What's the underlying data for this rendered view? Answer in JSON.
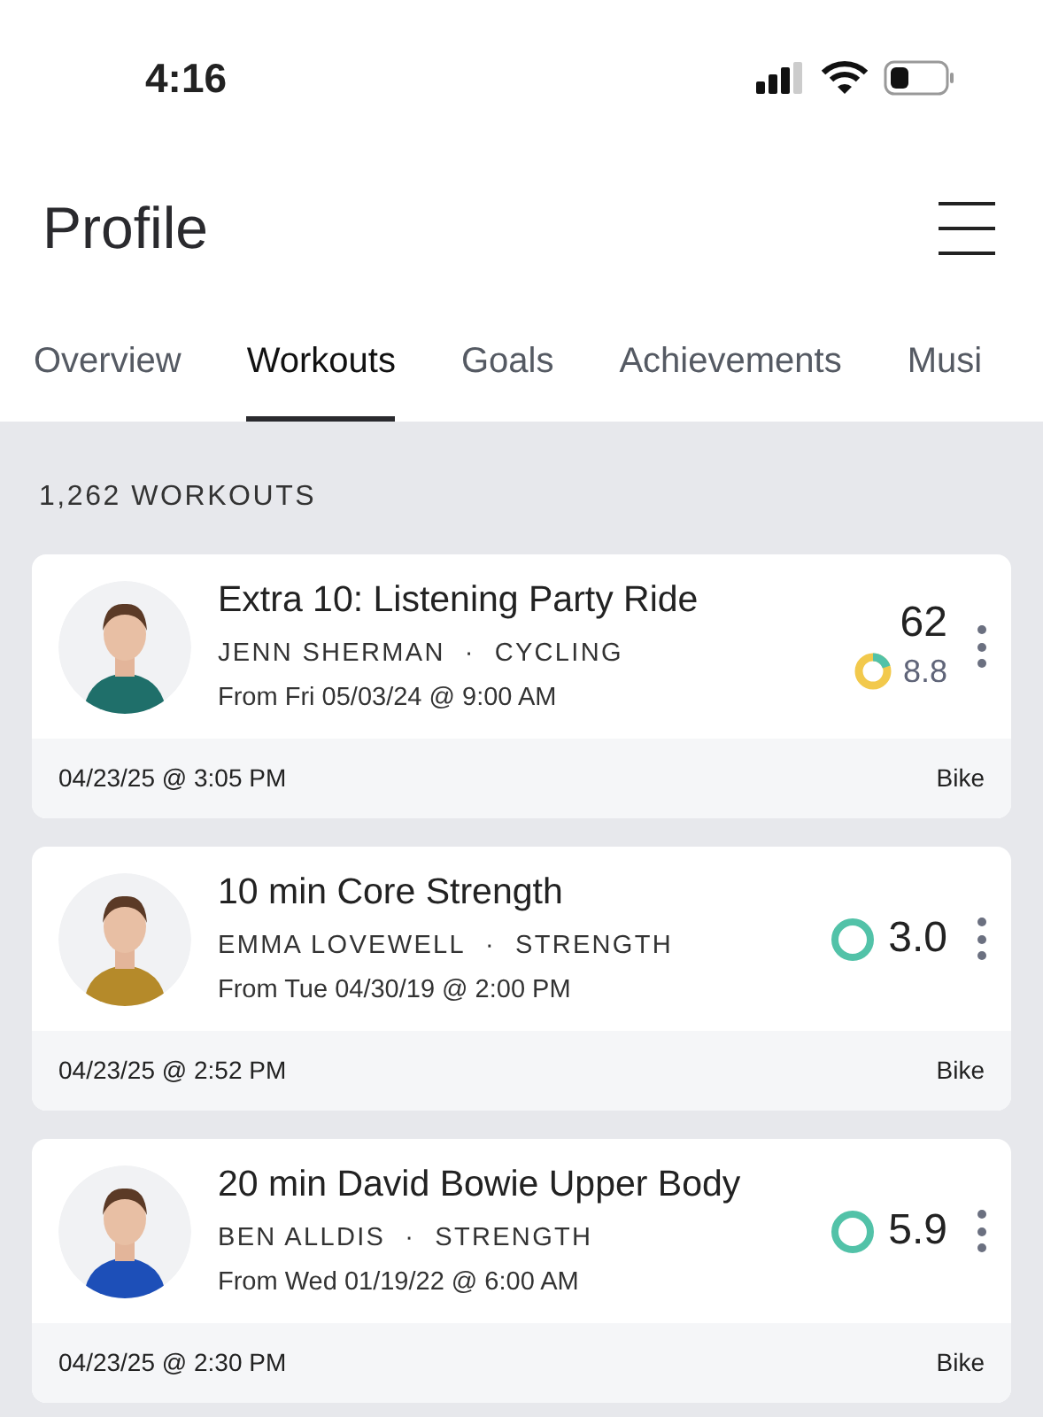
{
  "status_bar": {
    "time": "4:16"
  },
  "header": {
    "title": "Profile"
  },
  "tabs": [
    {
      "label": "Overview",
      "selected": false
    },
    {
      "label": "Workouts",
      "selected": true
    },
    {
      "label": "Goals",
      "selected": false
    },
    {
      "label": "Achievements",
      "selected": false
    },
    {
      "label": "Musi",
      "selected": false
    }
  ],
  "section_title": "1,262 WORKOUTS",
  "workouts": [
    {
      "title": "Extra 10: Listening Party Ride",
      "instructor": "JENN SHERMAN",
      "discipline": "CYCLING",
      "separator": "·",
      "original_air": "From Fri 05/03/24 @ 9:00 AM",
      "output": "62",
      "strain": "8.8",
      "kind": "zones",
      "date": "04/23/25 @ 3:05 PM",
      "platform": "Bike"
    },
    {
      "title": "10 min Core Strength",
      "instructor": "EMMA LOVEWELL",
      "discipline": "STRENGTH",
      "separator": "·",
      "original_air": "From Tue 04/30/19 @ 2:00 PM",
      "strain": "3.0",
      "kind": "solid",
      "date": "04/23/25 @ 2:52 PM",
      "platform": "Bike"
    },
    {
      "title": "20 min David Bowie Upper Body",
      "instructor": "BEN ALLDIS",
      "discipline": "STRENGTH",
      "separator": "·",
      "original_air": "From Wed 01/19/22 @ 6:00 AM",
      "strain": "5.9",
      "kind": "solid",
      "date": "04/23/25 @ 2:30 PM",
      "platform": "Bike"
    }
  ]
}
